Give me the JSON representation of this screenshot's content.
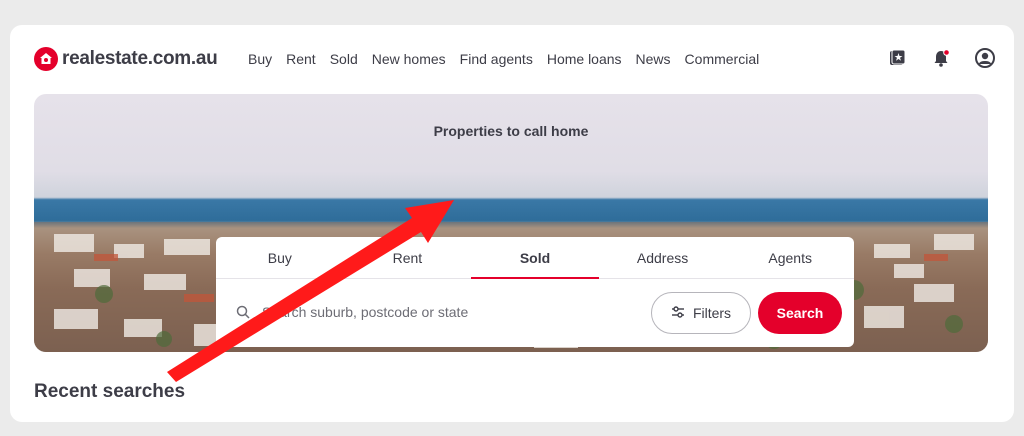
{
  "brand": {
    "name": "realestate.com.au",
    "color": "#e4002b"
  },
  "nav": [
    "Buy",
    "Rent",
    "Sold",
    "New homes",
    "Find agents",
    "Home loans",
    "News",
    "Commercial"
  ],
  "top_icons": [
    "saved-properties-icon",
    "notifications-icon",
    "user-account-icon"
  ],
  "hero": {
    "title": "Properties to call home"
  },
  "tabs": {
    "items": [
      "Buy",
      "Rent",
      "Sold",
      "Address",
      "Agents"
    ],
    "active": "Sold"
  },
  "search": {
    "placeholder": "Search suburb, postcode or state",
    "filters_label": "Filters",
    "search_label": "Search"
  },
  "recent": {
    "heading": "Recent searches"
  },
  "colors": {
    "accent": "#e4002b",
    "text": "#3d3d47",
    "annotation_arrow": "#ff1a1a"
  }
}
